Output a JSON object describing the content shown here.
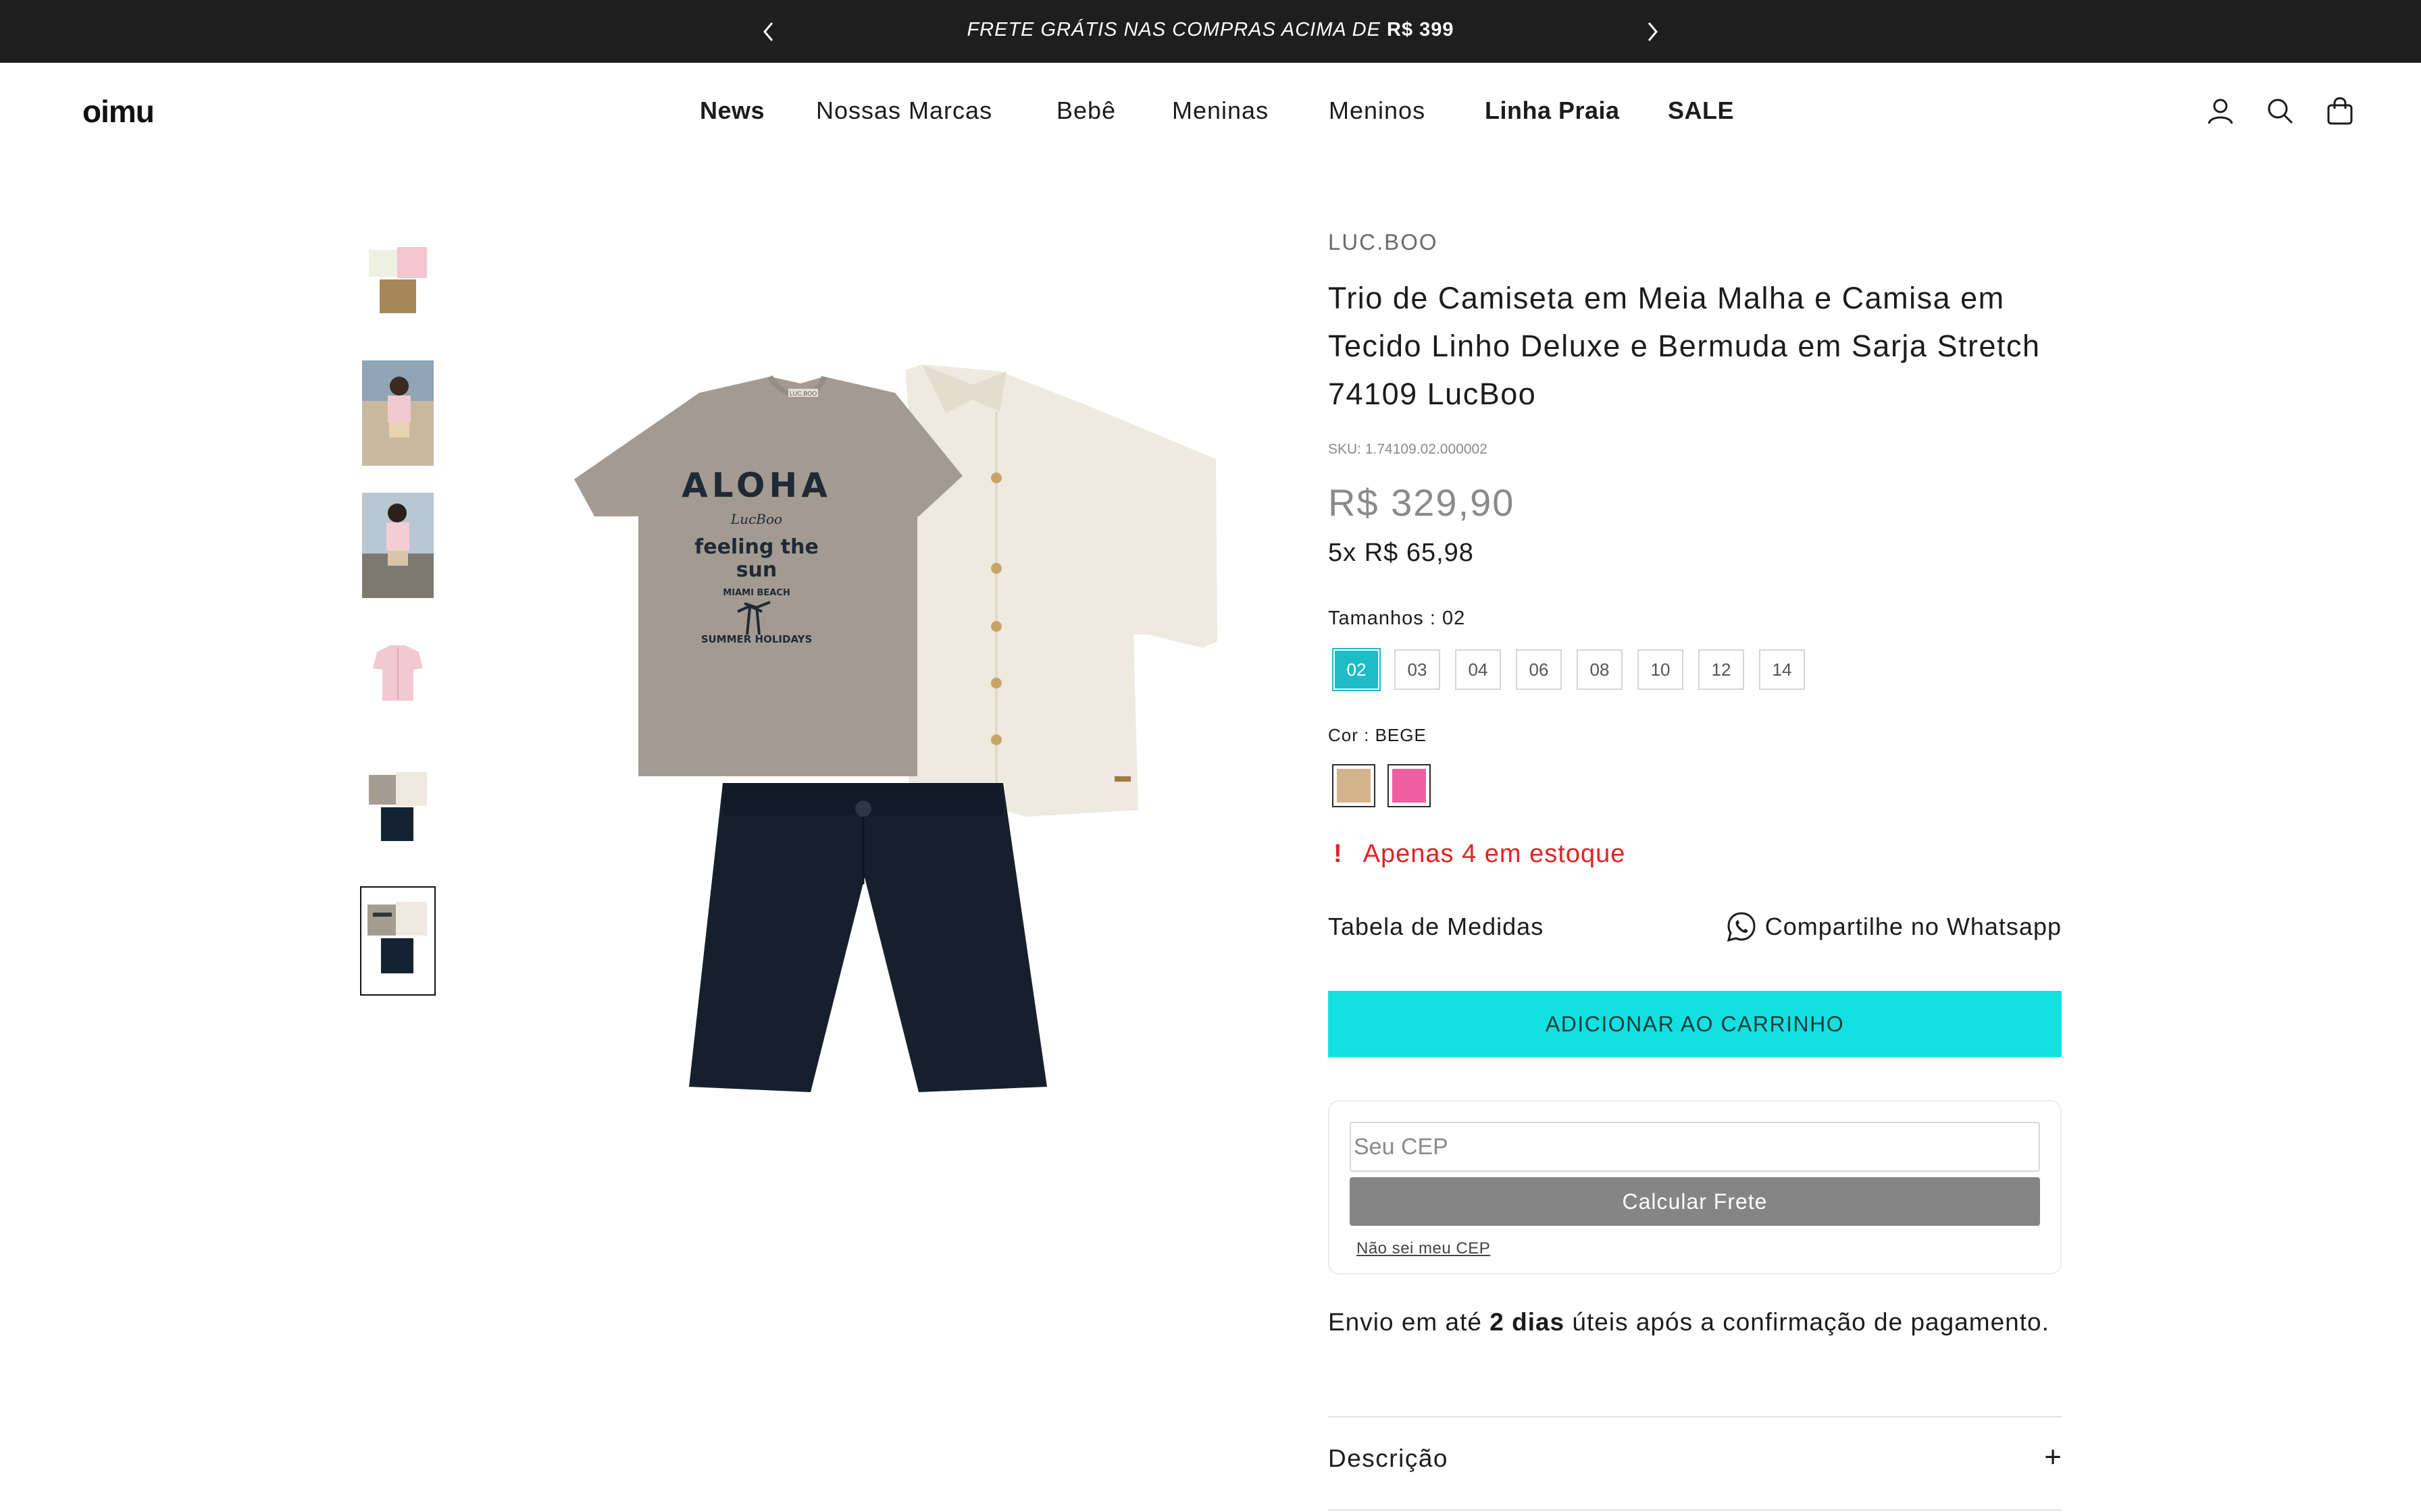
{
  "announcement": {
    "text": "FRETE GRÁTIS NAS COMPRAS ACIMA DE ",
    "highlight": "R$ 399"
  },
  "header": {
    "logo": "oimu",
    "nav": [
      {
        "label": "News",
        "bold": true
      },
      {
        "label": "Nossas Marcas",
        "bold": false
      },
      {
        "label": "Bebê",
        "bold": false
      },
      {
        "label": "Meninas",
        "bold": false
      },
      {
        "label": "Meninos",
        "bold": false
      },
      {
        "label": "Linha Praia",
        "bold": true
      },
      {
        "label": "SALE",
        "bold": true
      }
    ],
    "icons": [
      "account-icon",
      "search-icon",
      "cart-icon"
    ]
  },
  "gallery": {
    "thumbnails": [
      "outfit-flat-lay",
      "boy-on-beach-front",
      "boy-on-beach-back",
      "pink-shirt",
      "outfit-beige-navy",
      "outfit-aloha-set"
    ],
    "active_index": 5,
    "main_image": {
      "tshirt_text": [
        "ALOHA",
        "LucBoo",
        "feeling the",
        "sun",
        "MIAMI BEACH",
        "SUMMER HOLIDAYS"
      ],
      "tag": "LUC.BOO"
    }
  },
  "product": {
    "brand": "LUC.BOO",
    "title": "Trio de Camiseta em Meia Malha e Camisa em Tecido Linho Deluxe e Bermuda em Sarja Stretch 74109 LucBoo",
    "sku": "SKU: 1.74109.02.000002",
    "price": "R$ 329,90",
    "installments_prefix": "5x ",
    "installments_value": "R$ 65,98",
    "size_label": "Tamanhos : ",
    "size_selected": "02",
    "sizes": [
      "02",
      "03",
      "04",
      "06",
      "08",
      "10",
      "12",
      "14"
    ],
    "color_label": "Cor : ",
    "color_selected": "BEGE",
    "colors": [
      "#d5b38b",
      "#ee5fa2"
    ],
    "stock_icon": "!",
    "stock_text": "Apenas 4 em estoque",
    "size_chart": "Tabela de Medidas",
    "whatsapp": "Compartilhe no Whatsapp",
    "add_to_cart": "ADICIONAR AO CARRINHO",
    "cep_placeholder": "Seu CEP",
    "cep_button": "Calcular Frete",
    "cep_link": "Não sei meu CEP",
    "shipping_prefix": "Envio em até ",
    "shipping_bold": "2 dias",
    "shipping_suffix": " úteis após a confirmação de pagamento.",
    "description_label": "Descrição",
    "description_toggle": "+"
  },
  "colors": {
    "topbar": "#1e1e1e",
    "accent": "#13e0e0",
    "size_selected": "#1dbcc6",
    "stock": "#e22222"
  }
}
